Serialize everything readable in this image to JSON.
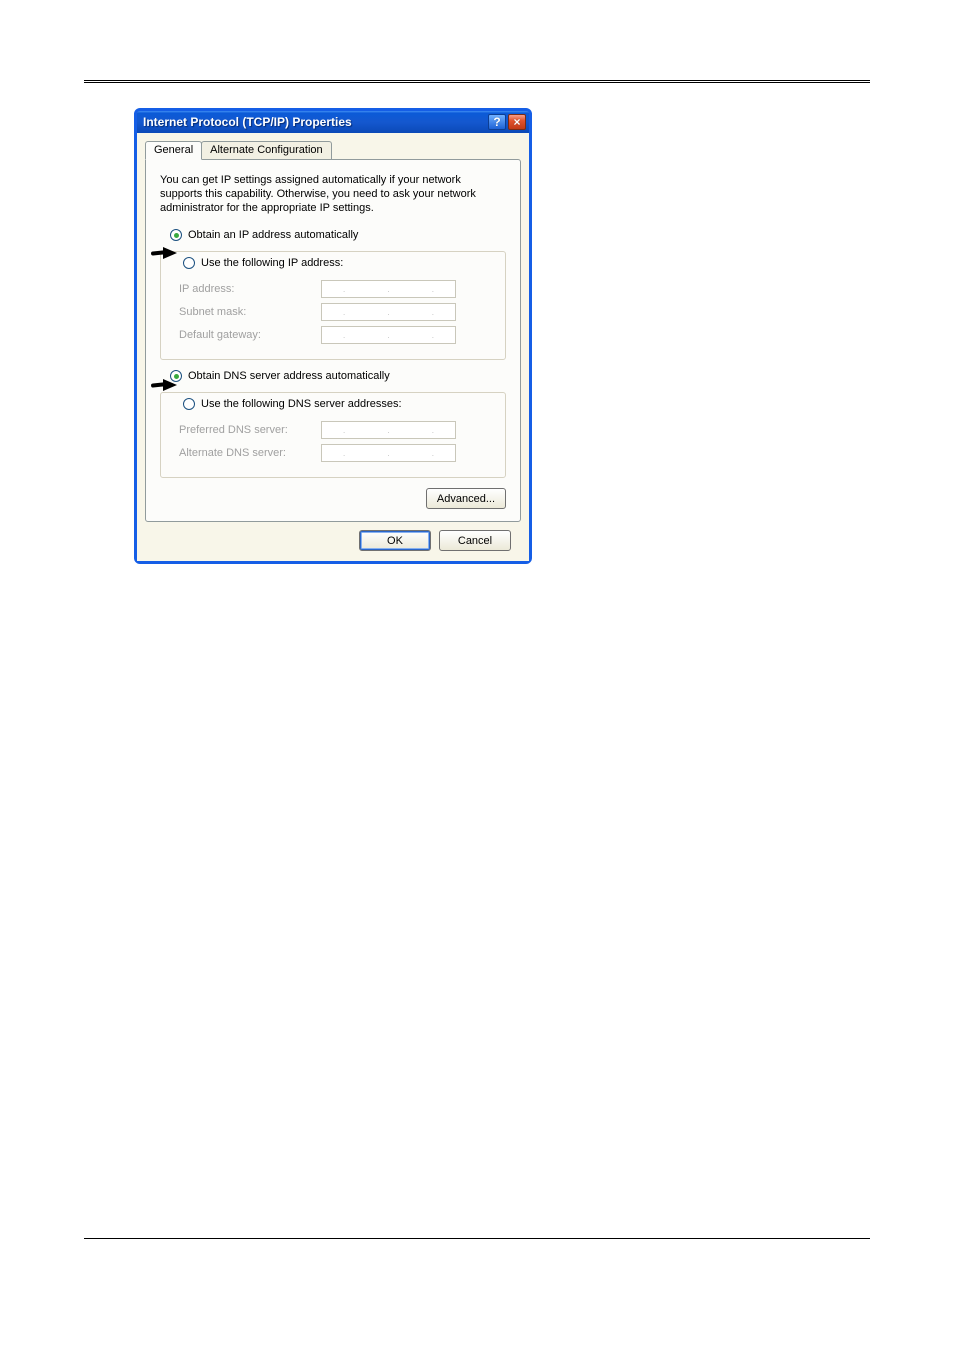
{
  "window": {
    "title": "Internet Protocol (TCP/IP) Properties",
    "help": "?",
    "close": "×"
  },
  "tabs": {
    "general": "General",
    "alternate": "Alternate Configuration"
  },
  "intro": "You can get IP settings assigned automatically if your network supports this capability. Otherwise, you need to ask your network administrator for the appropriate IP settings.",
  "ip": {
    "auto": "Obtain an IP address automatically",
    "manual": "Use the following IP address:",
    "addr": "IP address:",
    "mask": "Subnet mask:",
    "gateway": "Default gateway:"
  },
  "dns": {
    "auto": "Obtain DNS server address automatically",
    "manual": "Use the following DNS server addresses:",
    "preferred": "Preferred DNS server:",
    "alternate": "Alternate DNS server:"
  },
  "buttons": {
    "advanced": "Advanced...",
    "ok": "OK",
    "cancel": "Cancel"
  }
}
